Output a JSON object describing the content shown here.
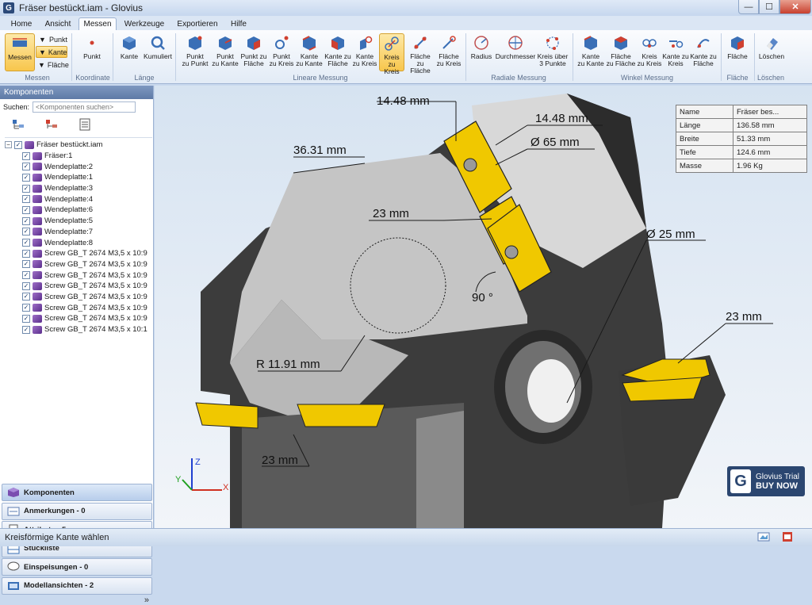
{
  "window": {
    "app_icon_letter": "G",
    "title": "Fräser bestückt.iam - Glovius",
    "min_glyph": "—",
    "max_glyph": "☐",
    "close_glyph": "✕"
  },
  "ribbon_tabs": [
    {
      "label": "Home"
    },
    {
      "label": "Ansicht"
    },
    {
      "label": "Messen",
      "active": true
    },
    {
      "label": "Werkzeuge"
    },
    {
      "label": "Exportieren"
    },
    {
      "label": "Hilfe"
    }
  ],
  "ribbon": {
    "messen_button": "Messen",
    "mode_options": [
      {
        "label": "Punkt"
      },
      {
        "label": "Kante",
        "active": true
      },
      {
        "label": "Fläche"
      }
    ],
    "punkt_button": "Punkt",
    "laenge_buttons": [
      {
        "label1": "Kante",
        "label2": ""
      },
      {
        "label1": "Kumuliert",
        "label2": ""
      }
    ],
    "linear_buttons": [
      {
        "label1": "Punkt",
        "label2": "zu Punkt"
      },
      {
        "label1": "Punkt",
        "label2": "zu Kante"
      },
      {
        "label1": "Punkt zu",
        "label2": "Fläche"
      },
      {
        "label1": "Punkt",
        "label2": "zu Kreis"
      },
      {
        "label1": "Kante",
        "label2": "zu Kante"
      },
      {
        "label1": "Kante zu",
        "label2": "Fläche"
      },
      {
        "label1": "Kante",
        "label2": "zu Kreis"
      },
      {
        "label1": "Kreis",
        "label2": "zu Kreis",
        "active": true
      },
      {
        "label1": "Fläche",
        "label2": "zu Fläche"
      },
      {
        "label1": "Fläche",
        "label2": "zu Kreis"
      }
    ],
    "radial_buttons": [
      {
        "label1": "Radius",
        "label2": ""
      },
      {
        "label1": "Durchmesser",
        "label2": ""
      },
      {
        "label1": "Kreis über",
        "label2": "3 Punkte"
      }
    ],
    "winkel_buttons": [
      {
        "label1": "Kante",
        "label2": "zu Kante"
      },
      {
        "label1": "Fläche",
        "label2": "zu Fläche"
      },
      {
        "label1": "Kreis",
        "label2": "zu Kreis"
      },
      {
        "label1": "Kante zu",
        "label2": "Kreis"
      },
      {
        "label1": "Kante zu",
        "label2": "Fläche"
      }
    ],
    "flaeche_button": "Fläche",
    "loeschen_button": "Löschen",
    "groups": {
      "messen": "Messen",
      "koordinate": "Koordinate",
      "laenge": "Länge",
      "linear": "Lineare Messung",
      "radial": "Radiale Messung",
      "winkel": "Winkel Messung",
      "flaeche": "Fläche",
      "loeschen": "Löschen"
    },
    "colors": {
      "accent_active": "#f8c64c",
      "icon_blue": "#3a6fb6",
      "icon_red": "#d04030"
    }
  },
  "left_panel": {
    "header": "Komponenten",
    "search_label": "Suchen:",
    "search_placeholder": "<Komponenten suchen>",
    "tree_root": "Fräser bestückt.iam",
    "tree_items": [
      "Fräser:1",
      "Wendeplatte:2",
      "Wendeplatte:1",
      "Wendeplatte:3",
      "Wendeplatte:4",
      "Wendeplatte:6",
      "Wendeplatte:5",
      "Wendeplatte:7",
      "Wendeplatte:8",
      "Screw GB_T 2674 M3,5 x 10:9",
      "Screw GB_T 2674 M3,5 x 10:9",
      "Screw GB_T 2674 M3,5 x 10:9",
      "Screw GB_T 2674 M3,5 x 10:9",
      "Screw GB_T 2674 M3,5 x 10:9",
      "Screw GB_T 2674 M3,5 x 10:9",
      "Screw GB_T 2674 M3,5 x 10:9",
      "Screw GB_T 2674 M3,5 x 10:1"
    ],
    "nav": [
      {
        "label": "Komponenten",
        "active": true
      },
      {
        "label": "Anmerkungen - 0"
      },
      {
        "label": "Attribute - 5"
      },
      {
        "label": "Stückliste"
      },
      {
        "label": "Einspeisungen - 0"
      },
      {
        "label": "Modellansichten - 2"
      }
    ],
    "more_glyph": "»"
  },
  "viewport": {
    "annotations": [
      "14.48 mm",
      "14.48 mm",
      "36.31 mm",
      "Ø 65 mm",
      "23 mm",
      "Ø 25 mm",
      "90 °",
      "23 mm",
      "R 11.91 mm",
      "23 mm"
    ],
    "axes": {
      "x": "X",
      "y": "Y",
      "z": "Z"
    },
    "properties": [
      {
        "key": "Name",
        "value": "Fräser bes..."
      },
      {
        "key": "Länge",
        "value": "136.58 mm"
      },
      {
        "key": "Breite",
        "value": "51.33 mm"
      },
      {
        "key": "Tiefe",
        "value": "124.6 mm"
      },
      {
        "key": "Masse",
        "value": "1.96 Kg"
      }
    ],
    "trial_badge": {
      "logo": "G",
      "line1": "Glovius Trial",
      "line2": "BUY NOW"
    },
    "colors": {
      "body_dark": "#3a3a3a",
      "body_light": "#c8c8c8",
      "insert_yellow": "#f0c800"
    }
  },
  "status": {
    "text": "Kreisförmige Kante wählen"
  }
}
